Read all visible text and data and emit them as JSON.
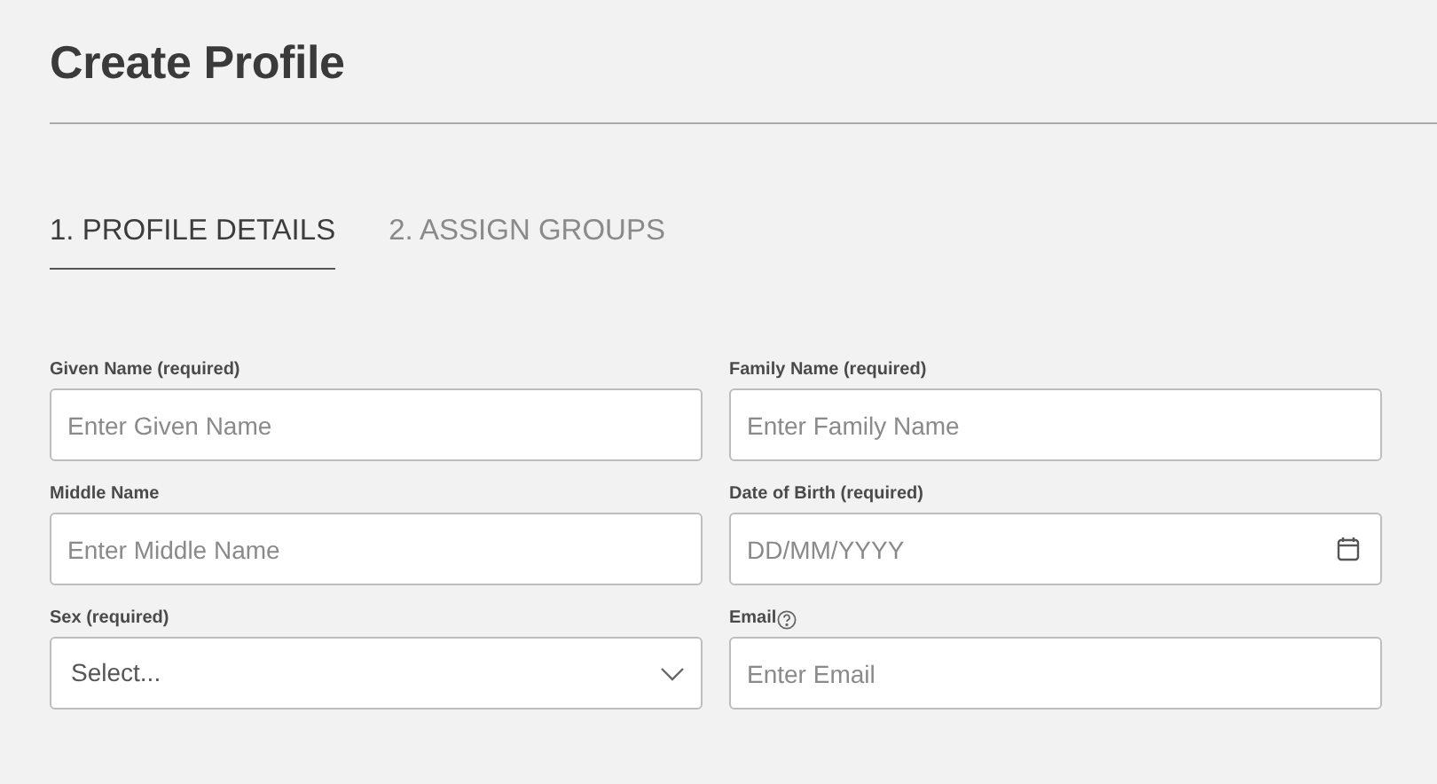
{
  "page_title": "Create Profile",
  "steps": [
    {
      "label": "1. PROFILE DETAILS",
      "selected": true
    },
    {
      "label": "2. ASSIGN GROUPS",
      "selected": false
    }
  ],
  "fields": [
    {
      "label": "Given Name (required)",
      "kind": "text",
      "placeholder": "Enter Given Name",
      "help": false
    },
    {
      "label": "Family Name (required)",
      "kind": "text",
      "placeholder": "Enter Family Name",
      "help": false
    },
    {
      "label": "Middle Name",
      "kind": "text",
      "placeholder": "Enter Middle Name",
      "help": false
    },
    {
      "label": "Date of Birth (required)",
      "kind": "date",
      "placeholder": "DD/MM/YYYY",
      "help": false
    },
    {
      "label": "Sex (required)",
      "kind": "select",
      "placeholder": "Select...",
      "help": false
    },
    {
      "label": "Email",
      "kind": "text",
      "placeholder": "Enter Email",
      "help": true
    }
  ]
}
